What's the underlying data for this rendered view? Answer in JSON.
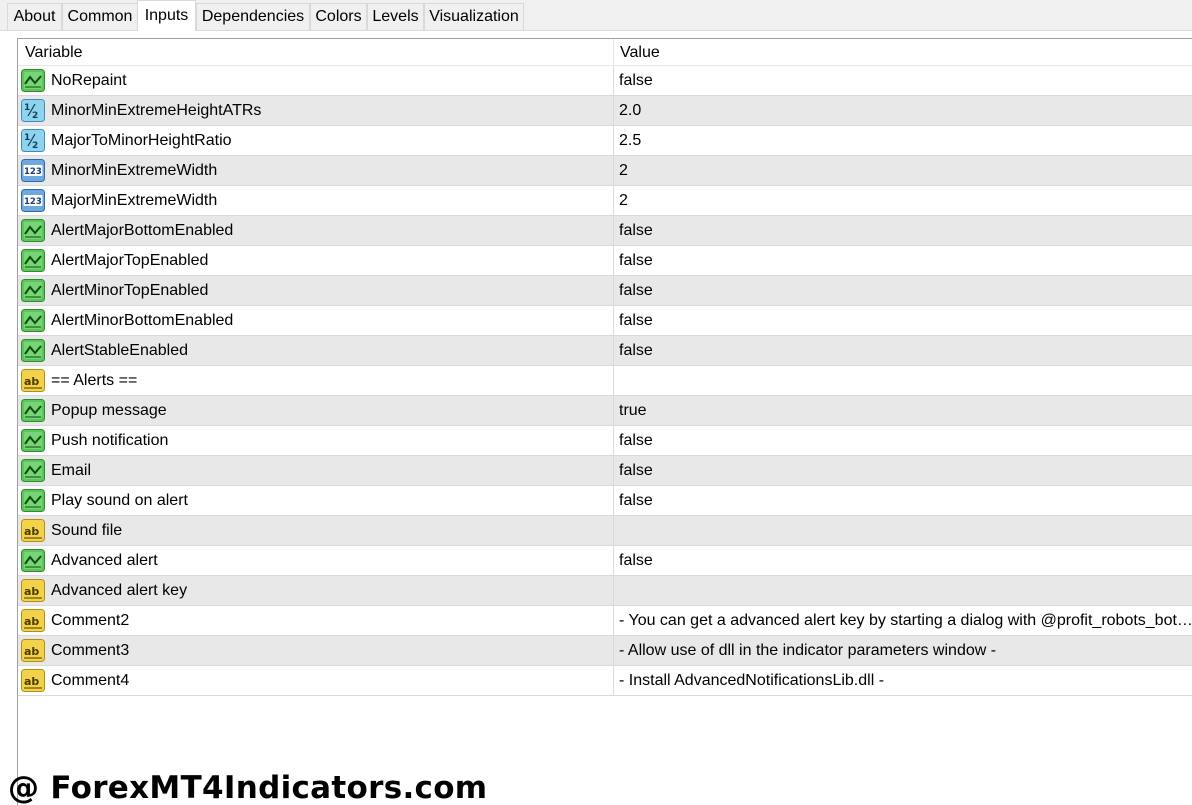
{
  "tabs": [
    {
      "label": "About",
      "active": false
    },
    {
      "label": "Common",
      "active": false
    },
    {
      "label": "Inputs",
      "active": true
    },
    {
      "label": "Dependencies",
      "active": false
    },
    {
      "label": "Colors",
      "active": false
    },
    {
      "label": "Levels",
      "active": false
    },
    {
      "label": "Visualization",
      "active": false
    }
  ],
  "table": {
    "columns": {
      "variable": "Variable",
      "value": "Value"
    },
    "rows": [
      {
        "icon": "bool-icon",
        "variable": "NoRepaint",
        "value": "false"
      },
      {
        "icon": "double-icon",
        "variable": "MinorMinExtremeHeightATRs",
        "value": "2.0"
      },
      {
        "icon": "double-icon",
        "variable": "MajorToMinorHeightRatio",
        "value": "2.5"
      },
      {
        "icon": "integer-icon",
        "variable": "MinorMinExtremeWidth",
        "value": "2"
      },
      {
        "icon": "integer-icon",
        "variable": "MajorMinExtremeWidth",
        "value": "2"
      },
      {
        "icon": "bool-icon",
        "variable": "AlertMajorBottomEnabled",
        "value": "false"
      },
      {
        "icon": "bool-icon",
        "variable": "AlertMajorTopEnabled",
        "value": "false"
      },
      {
        "icon": "bool-icon",
        "variable": "AlertMinorTopEnabled",
        "value": "false"
      },
      {
        "icon": "bool-icon",
        "variable": "AlertMinorBottomEnabled",
        "value": "false"
      },
      {
        "icon": "bool-icon",
        "variable": "AlertStableEnabled",
        "value": "false"
      },
      {
        "icon": "string-icon",
        "variable": "== Alerts ==",
        "value": ""
      },
      {
        "icon": "bool-icon",
        "variable": "Popup message",
        "value": "true"
      },
      {
        "icon": "bool-icon",
        "variable": "Push notification",
        "value": "false"
      },
      {
        "icon": "bool-icon",
        "variable": "Email",
        "value": "false"
      },
      {
        "icon": "bool-icon",
        "variable": "Play sound on alert",
        "value": "false"
      },
      {
        "icon": "string-icon",
        "variable": "Sound file",
        "value": ""
      },
      {
        "icon": "bool-icon",
        "variable": "Advanced alert",
        "value": "false"
      },
      {
        "icon": "string-icon",
        "variable": "Advanced alert key",
        "value": ""
      },
      {
        "icon": "string-icon",
        "variable": "Comment2",
        "value": "- You can get a advanced alert key by starting a dialog with @profit_robots_bot T..."
      },
      {
        "icon": "string-icon",
        "variable": "Comment3",
        "value": "- Allow use of dll in the indicator parameters window -"
      },
      {
        "icon": "string-icon",
        "variable": "Comment4",
        "value": "- Install AdvancedNotificationsLib.dll -"
      }
    ]
  },
  "watermark": "@ ForexMT4Indicators.com",
  "colors": {
    "bool_icon": "#5cc65c",
    "double_icon": "#8fd3ef",
    "integer_icon": "#6fa8dc",
    "string_icon": "#f2d24a",
    "row_alt": "#e8e8e8"
  }
}
